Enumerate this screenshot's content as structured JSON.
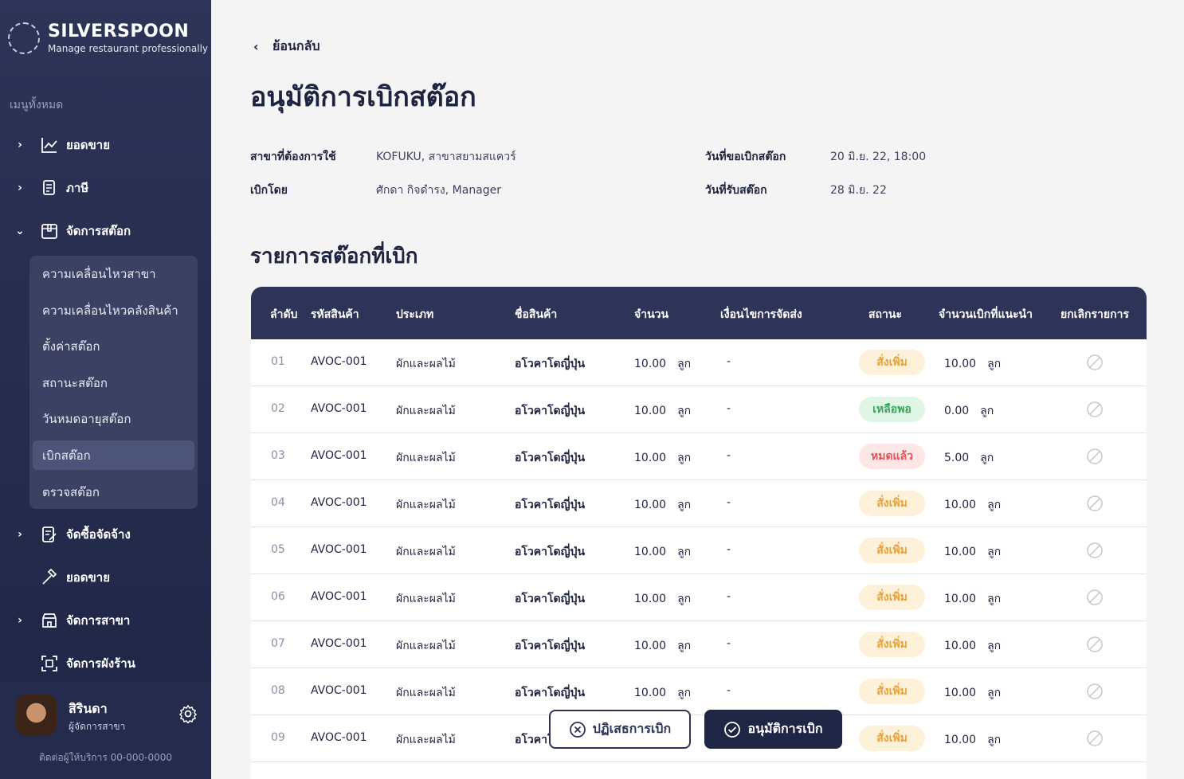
{
  "brand": {
    "name": "SILVERSPOON",
    "tagline": "Manage restaurant professionally"
  },
  "sidebar": {
    "menu_header": "เมนูทั้งหมด",
    "items": [
      {
        "label": "ยอดขาย",
        "icon": "chart-line-icon"
      },
      {
        "label": "ภาษี",
        "icon": "receipt-icon"
      },
      {
        "label": "จัดการสต๊อก",
        "icon": "box-icon"
      },
      {
        "label": "จัดซื้อจัดจ้าง",
        "icon": "edit-document-icon"
      },
      {
        "label": "ยอดขาย",
        "icon": "hammer-icon"
      },
      {
        "label": "จัดการสาขา",
        "icon": "store-icon"
      },
      {
        "label": "จัดการผังร้าน",
        "icon": "layout-scan-icon"
      }
    ],
    "stock_submenu": [
      "ความเคลื่อนไหวสาขา",
      "ความเคลื่อนไหวคลังสินค้า",
      "ตั้งค่าสต๊อก",
      "สถานะสต๊อก",
      "วันหมดอายุสต๊อก",
      "เบิกสต๊อก",
      "ตรวจสต๊อก"
    ],
    "active_sub": "เบิกสต๊อก"
  },
  "user": {
    "name": "สิรินดา",
    "role": "ผู้จัดการสาขา",
    "contact": "ติดต่อผู้ให้บริการ 00-000-0000"
  },
  "header": {
    "back_label": "ย้อนกลับ",
    "title": "อนุมัติการเบิกสต๊อก"
  },
  "info": {
    "branch_label": "สาขาที่ต้องการใช้",
    "branch_value": "KOFUKU, สาขาสยามสแควร์",
    "requester_label": "เบิกโดย",
    "requester_value": "ศักดา กิจดำรง, Manager",
    "request_date_label": "วันที่ขอเบิกสต๊อก",
    "request_date_value": "20 มิ.ย. 22, 18:00",
    "receive_date_label": "วันที่รับสต๊อก",
    "receive_date_value": "28 มิ.ย. 22"
  },
  "table": {
    "section_title": "รายการสต๊อกที่เบิก",
    "headers": [
      "ลำดับ",
      "รหัสสินค้า",
      "ประเภท",
      "ชื่อสินค้า",
      "จำนวน",
      "เงื่อนไขการจัดส่ง",
      "สถานะ",
      "จำนวนเบิกที่แนะนำ",
      "ยกเลิกรายการ"
    ],
    "rows": [
      {
        "idx": "01",
        "code": "AVOC-001",
        "category": "ผักและผลไม้",
        "name": "อโวคาโดญี่ปุ่น",
        "qty": "10.00",
        "unit": "ลูก",
        "condition": "-",
        "status": "สั่งเพิ่ม",
        "status_type": "order",
        "suggest": "10.00",
        "suggest_unit": "ลูก"
      },
      {
        "idx": "02",
        "code": "AVOC-001",
        "category": "ผักและผลไม้",
        "name": "อโวคาโดญี่ปุ่น",
        "qty": "10.00",
        "unit": "ลูก",
        "condition": "-",
        "status": "เหลือพอ",
        "status_type": "enough",
        "suggest": "0.00",
        "suggest_unit": "ลูก"
      },
      {
        "idx": "03",
        "code": "AVOC-001",
        "category": "ผักและผลไม้",
        "name": "อโวคาโดญี่ปุ่น",
        "qty": "10.00",
        "unit": "ลูก",
        "condition": "-",
        "status": "หมดแล้ว",
        "status_type": "out",
        "suggest": "5.00",
        "suggest_unit": "ลูก"
      },
      {
        "idx": "04",
        "code": "AVOC-001",
        "category": "ผักและผลไม้",
        "name": "อโวคาโดญี่ปุ่น",
        "qty": "10.00",
        "unit": "ลูก",
        "condition": "-",
        "status": "สั่งเพิ่ม",
        "status_type": "order",
        "suggest": "10.00",
        "suggest_unit": "ลูก"
      },
      {
        "idx": "05",
        "code": "AVOC-001",
        "category": "ผักและผลไม้",
        "name": "อโวคาโดญี่ปุ่น",
        "qty": "10.00",
        "unit": "ลูก",
        "condition": "-",
        "status": "สั่งเพิ่ม",
        "status_type": "order",
        "suggest": "10.00",
        "suggest_unit": "ลูก"
      },
      {
        "idx": "06",
        "code": "AVOC-001",
        "category": "ผักและผลไม้",
        "name": "อโวคาโดญี่ปุ่น",
        "qty": "10.00",
        "unit": "ลูก",
        "condition": "-",
        "status": "สั่งเพิ่ม",
        "status_type": "order",
        "suggest": "10.00",
        "suggest_unit": "ลูก"
      },
      {
        "idx": "07",
        "code": "AVOC-001",
        "category": "ผักและผลไม้",
        "name": "อโวคาโดญี่ปุ่น",
        "qty": "10.00",
        "unit": "ลูก",
        "condition": "-",
        "status": "สั่งเพิ่ม",
        "status_type": "order",
        "suggest": "10.00",
        "suggest_unit": "ลูก"
      },
      {
        "idx": "08",
        "code": "AVOC-001",
        "category": "ผักและผลไม้",
        "name": "อโวคาโดญี่ปุ่น",
        "qty": "10.00",
        "unit": "ลูก",
        "condition": "-",
        "status": "สั่งเพิ่ม",
        "status_type": "order",
        "suggest": "10.00",
        "suggest_unit": "ลูก"
      },
      {
        "idx": "09",
        "code": "AVOC-001",
        "category": "ผักและผลไม้",
        "name": "อโวคาโดญี่ปุ่น",
        "qty": "10.00",
        "unit": "ลูก",
        "condition": "-",
        "status": "สั่งเพิ่ม",
        "status_type": "order",
        "suggest": "10.00",
        "suggest_unit": "ลูก"
      }
    ]
  },
  "actions": {
    "reject_label": "ปฏิเสธการเบิก",
    "approve_label": "อนุมัติการเบิก"
  },
  "colors": {
    "sidebar": "#2d3457",
    "order": "#e8a23a",
    "enough": "#36a657",
    "out": "#e05656"
  }
}
